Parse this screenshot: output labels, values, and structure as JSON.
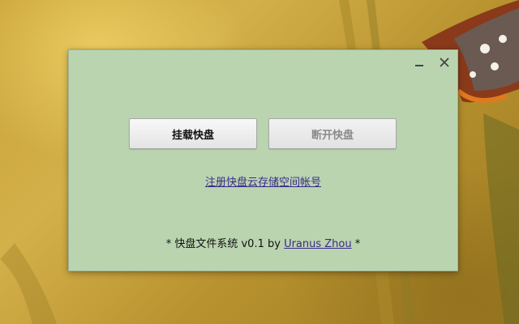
{
  "window": {
    "background": "#bad4b0",
    "minimize_symbol": "–",
    "close_symbol": "✕"
  },
  "buttons": {
    "mount_label": "挂载快盘",
    "disconnect_label": "断开快盘"
  },
  "register_link": "注册快盘云存储空间帐号",
  "footer": {
    "prefix": "* 快盘文件系统 v0.1 by ",
    "author": "Uranus Zhou",
    "suffix": " *"
  },
  "colors": {
    "link": "#3a2a8a",
    "disabled_text": "#8a8a8a"
  }
}
